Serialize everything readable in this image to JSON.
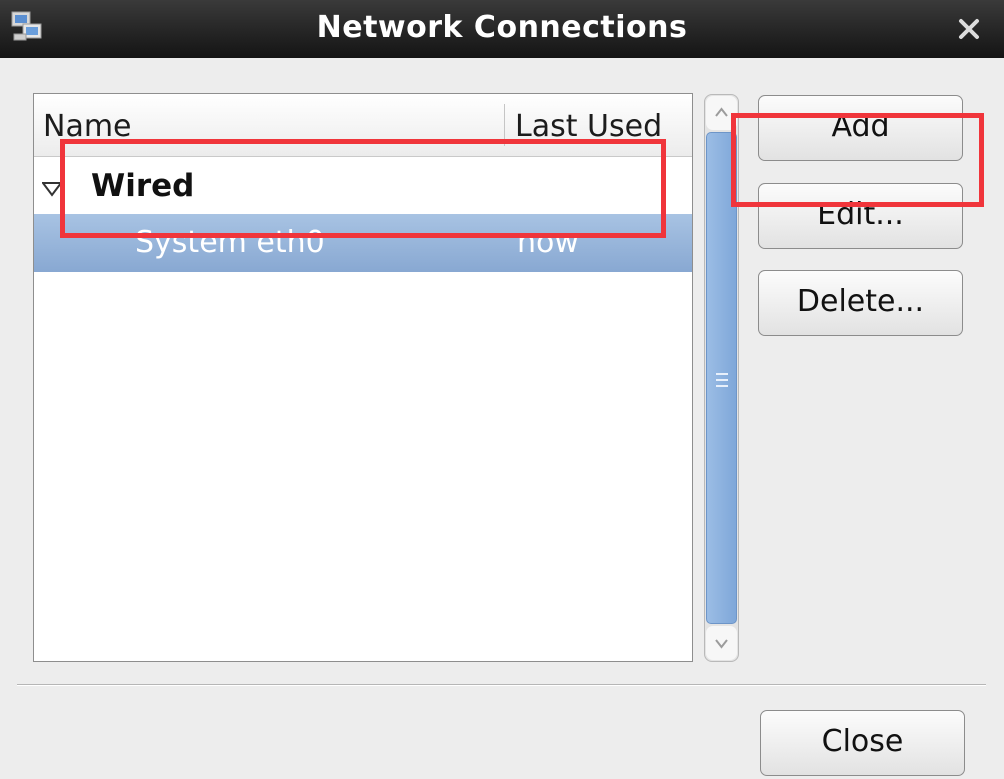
{
  "window": {
    "title": "Network Connections",
    "icon": "network-computers-icon",
    "close_icon": "close-icon"
  },
  "list": {
    "columns": [
      "Name",
      "Last Used"
    ],
    "groups": [
      {
        "label": "Wired",
        "expanded": true,
        "connections": [
          {
            "name": "System eth0",
            "last_used": "now",
            "selected": true
          }
        ]
      }
    ]
  },
  "buttons": {
    "add": "Add",
    "edit": "Edit...",
    "delete": "Delete...",
    "close": "Close"
  },
  "colors": {
    "selection": "#8fb0d8",
    "highlight": "#f0353b",
    "titlebar": "#1e1e1e"
  }
}
